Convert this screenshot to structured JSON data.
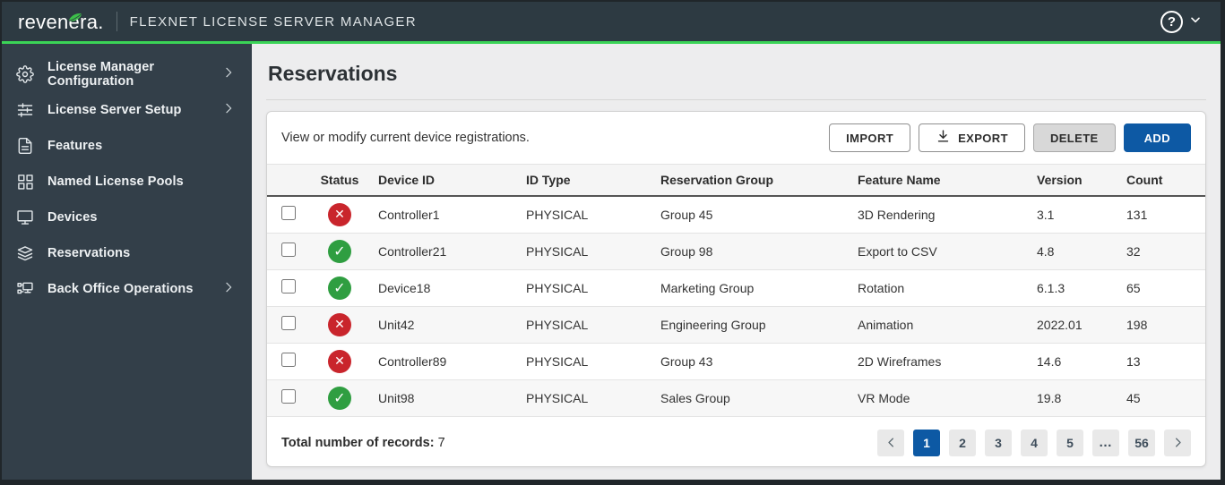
{
  "header": {
    "logo_text": "revenera.",
    "app_title": "FLEXNET LICENSE SERVER MANAGER"
  },
  "sidebar": {
    "items": [
      {
        "label": "License Manager Configuration",
        "icon": "gear-icon",
        "expandable": true
      },
      {
        "label": "License Server Setup",
        "icon": "sliders-icon",
        "expandable": true
      },
      {
        "label": "Features",
        "icon": "document-icon",
        "expandable": false
      },
      {
        "label": "Named License Pools",
        "icon": "grid-icon",
        "expandable": false
      },
      {
        "label": "Devices",
        "icon": "monitor-icon",
        "expandable": false
      },
      {
        "label": "Reservations",
        "icon": "layers-icon",
        "expandable": false
      },
      {
        "label": "Back Office Operations",
        "icon": "network-icon",
        "expandable": true
      }
    ]
  },
  "page": {
    "title": "Reservations",
    "description": "View or modify current device registrations."
  },
  "toolbar": {
    "import_label": "IMPORT",
    "export_label": "EXPORT",
    "delete_label": "DELETE",
    "add_label": "ADD"
  },
  "table": {
    "columns": [
      "Status",
      "Device ID",
      "ID Type",
      "Reservation Group",
      "Feature Name",
      "Version",
      "Count"
    ],
    "rows": [
      {
        "status": "error",
        "device_id": "Controller1",
        "id_type": "PHYSICAL",
        "reservation_group": "Group 45",
        "feature_name": "3D Rendering",
        "version": "3.1",
        "count": "131"
      },
      {
        "status": "ok",
        "device_id": "Controller21",
        "id_type": "PHYSICAL",
        "reservation_group": "Group 98",
        "feature_name": "Export to CSV",
        "version": "4.8",
        "count": "32"
      },
      {
        "status": "ok",
        "device_id": "Device18",
        "id_type": "PHYSICAL",
        "reservation_group": "Marketing Group",
        "feature_name": "Rotation",
        "version": "6.1.3",
        "count": "65"
      },
      {
        "status": "error",
        "device_id": "Unit42",
        "id_type": "PHYSICAL",
        "reservation_group": "Engineering Group",
        "feature_name": "Animation",
        "version": "2022.01",
        "count": "198"
      },
      {
        "status": "error",
        "device_id": "Controller89",
        "id_type": "PHYSICAL",
        "reservation_group": "Group 43",
        "feature_name": "2D Wireframes",
        "version": "14.6",
        "count": "13"
      },
      {
        "status": "ok",
        "device_id": "Unit98",
        "id_type": "PHYSICAL",
        "reservation_group": "Sales Group",
        "feature_name": "VR Mode",
        "version": "19.8",
        "count": "45"
      }
    ]
  },
  "footer": {
    "total_label": "Total number of records:",
    "total_value": "7"
  },
  "pagination": {
    "active_page": "1",
    "pages": [
      "1",
      "2",
      "3",
      "4",
      "5",
      "…",
      "56"
    ]
  },
  "colors": {
    "accent_green": "#3bd457",
    "primary_blue": "#0d59a4",
    "status_error": "#c9252c",
    "status_ok": "#2f9e41",
    "header_bg": "#2d3a42",
    "sidebar_bg": "#333f49"
  }
}
